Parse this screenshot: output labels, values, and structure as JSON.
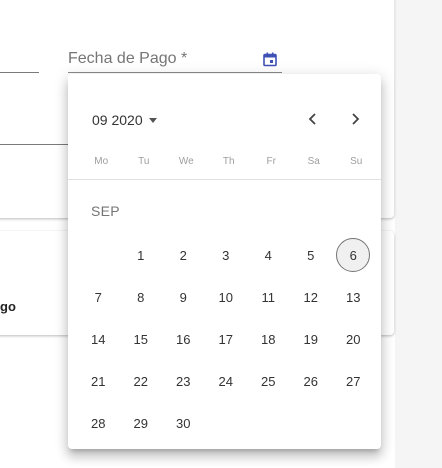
{
  "form": {
    "cut_label": "go",
    "date_field": {
      "label": "Fecha de Pago *",
      "icon": "calendar-icon",
      "accent_color": "#3f51b5"
    }
  },
  "picker": {
    "period_label": "09 2020",
    "prev_icon": "chevron-left-icon",
    "next_icon": "chevron-right-icon",
    "weekdays": [
      "Mo",
      "Tu",
      "We",
      "Th",
      "Fr",
      "Sa",
      "Su"
    ],
    "month_label": "SEP",
    "today": "6",
    "weeks": [
      [
        "",
        "1",
        "2",
        "3",
        "4",
        "5",
        "6"
      ],
      [
        "7",
        "8",
        "9",
        "10",
        "11",
        "12",
        "13"
      ],
      [
        "14",
        "15",
        "16",
        "17",
        "18",
        "19",
        "20"
      ],
      [
        "21",
        "22",
        "23",
        "24",
        "25",
        "26",
        "27"
      ],
      [
        "28",
        "29",
        "30",
        "",
        "",
        "",
        ""
      ]
    ]
  }
}
